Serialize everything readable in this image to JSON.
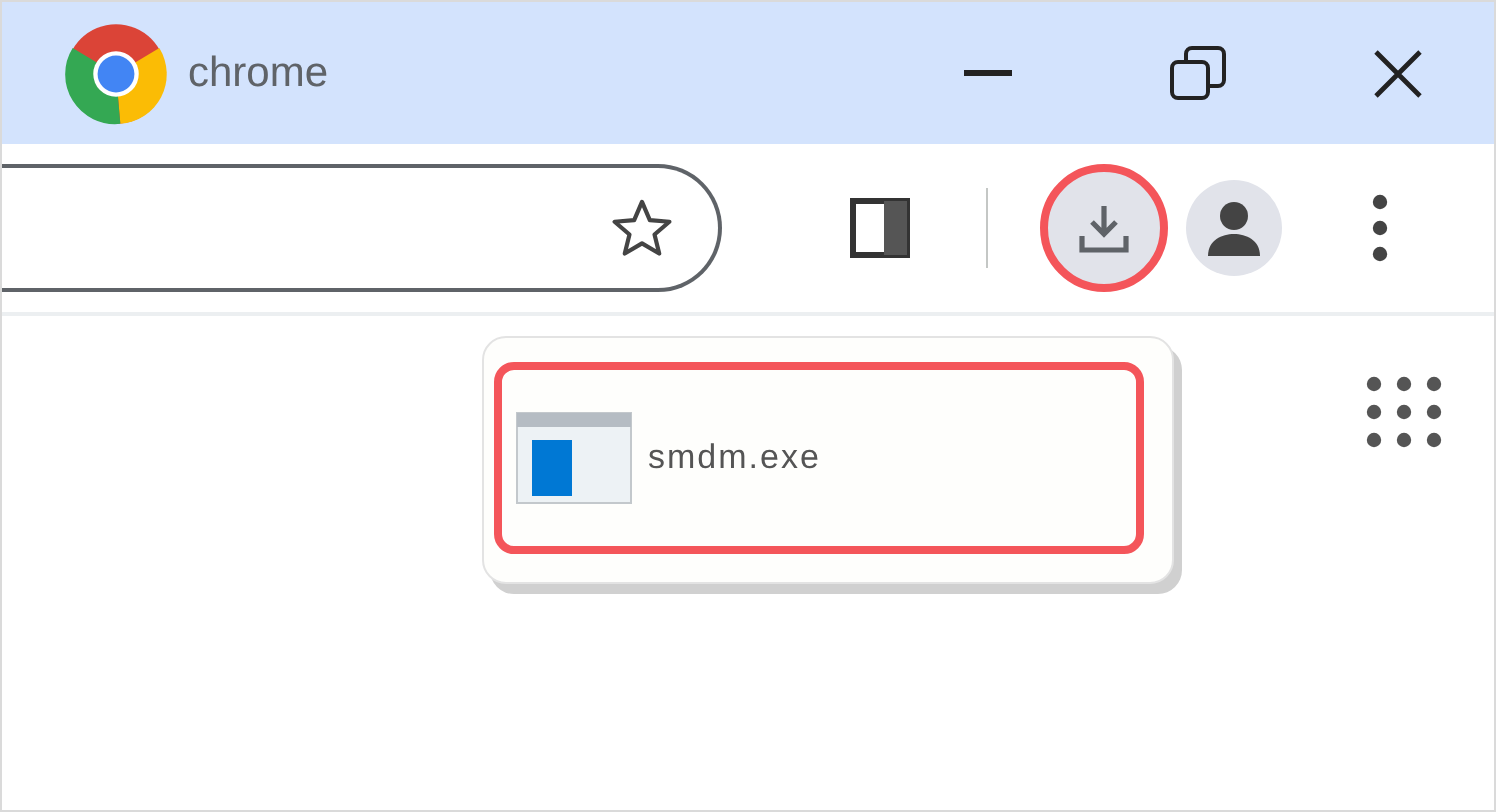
{
  "window": {
    "title": "chrome"
  },
  "toolbar": {
    "download_button": {
      "highlighted": true
    }
  },
  "downloads_popup": {
    "items": [
      {
        "file_name": "smdm.exe",
        "highlighted": true
      }
    ]
  }
}
